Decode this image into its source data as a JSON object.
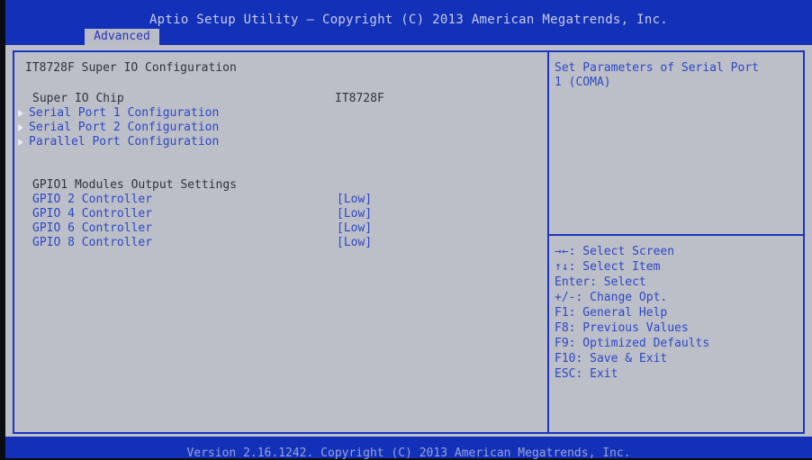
{
  "header": {
    "title": "Aptio Setup Utility – Copyright (C) 2013 American Megatrends, Inc.",
    "active_tab": "Advanced"
  },
  "main": {
    "section_title": "IT8728F Super IO Configuration",
    "chip_label": "Super IO Chip",
    "chip_value": "IT8728F",
    "submenus": [
      "Serial Port 1 Configuration",
      "Serial Port 2 Configuration",
      "Parallel Port Configuration"
    ],
    "gpio_heading": "GPIO1 Modules Output Settings",
    "gpio": [
      {
        "label": "GPIO 2 Controller",
        "value": "[Low]"
      },
      {
        "label": "GPIO 4 Controller",
        "value": "[Low]"
      },
      {
        "label": "GPIO 6 Controller",
        "value": "[Low]"
      },
      {
        "label": "GPIO 8 Controller",
        "value": "[Low]"
      }
    ]
  },
  "help": {
    "line1": "Set Parameters of Serial Port",
    "line2": "1 (COMA)"
  },
  "keys": [
    "→←: Select Screen",
    "↑↓: Select Item",
    "Enter: Select",
    "+/-: Change Opt.",
    "F1: General Help",
    "F8: Previous Values",
    "F9: Optimized Defaults",
    "F10: Save & Exit",
    "ESC: Exit"
  ],
  "footer": {
    "text": "Version 2.16.1242. Copyright (C) 2013 American Megatrends, Inc."
  },
  "colors": {
    "bar_blue": "#1230b8",
    "panel_gray": "#bcbec8",
    "link_blue": "#2c49c4"
  }
}
